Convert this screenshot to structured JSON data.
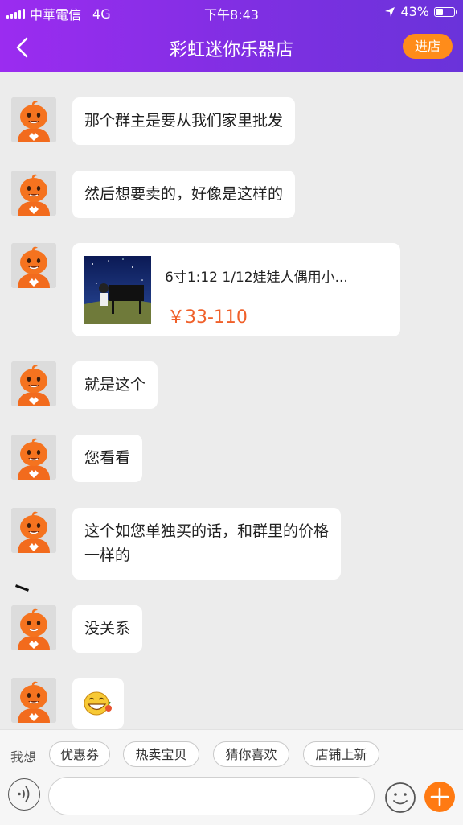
{
  "status_bar": {
    "carrier": "中華電信",
    "network": "4G",
    "time": "下午8:43",
    "battery": "43%",
    "battery_level": 0.43
  },
  "nav": {
    "title": "彩虹迷你乐器店",
    "enter_store_label": "进店"
  },
  "messages": [
    {
      "type": "text",
      "lines": [
        "那个群主是要从我们家里批发"
      ]
    },
    {
      "type": "text",
      "lines": [
        "然后想要卖的，好像是这样的"
      ]
    },
    {
      "type": "product",
      "title": "6寸1:12 1/12娃娃人偶用小...",
      "price": "￥33-110"
    },
    {
      "type": "text",
      "lines": [
        "就是这个"
      ]
    },
    {
      "type": "text",
      "lines": [
        "您看看"
      ]
    },
    {
      "type": "text",
      "lines": [
        "这个如您单独买的话，和群里的价格",
        "一样的"
      ]
    },
    {
      "type": "text",
      "lines": [
        "没关系"
      ]
    },
    {
      "type": "emoji",
      "icon": "grinning-face-emoji"
    }
  ],
  "quick_bar": {
    "label": "我想",
    "chips": [
      "优惠券",
      "热卖宝贝",
      "猜你喜欢",
      "店铺上新"
    ]
  },
  "input": {
    "placeholder": ""
  },
  "colors": {
    "header_gradient_start": "#9b2cf0",
    "header_gradient_end": "#6a33da",
    "accent_orange": "#ff8c1a",
    "price_color": "#f0602a",
    "chat_background": "#ececec"
  }
}
